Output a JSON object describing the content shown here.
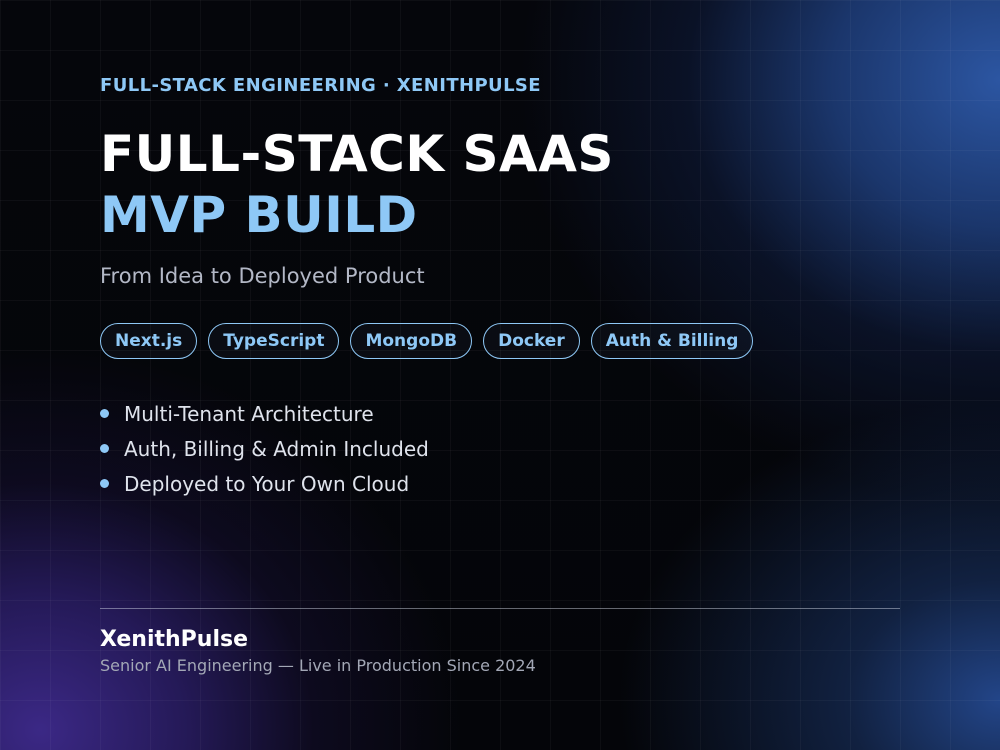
{
  "eyebrow": "FULL-STACK ENGINEERING · XENITHPULSE",
  "title": {
    "line1": "FULL-STACK SAAS",
    "line2": "MVP BUILD"
  },
  "subtitle": "From Idea to Deployed Product",
  "tags": [
    "Next.js",
    "TypeScript",
    "MongoDB",
    "Docker",
    "Auth & Billing"
  ],
  "bullets": [
    "Multi-Tenant Architecture",
    "Auth, Billing & Admin Included",
    "Deployed to Your Own Cloud"
  ],
  "footer": {
    "brand": "XenithPulse",
    "tagline": "Senior AI Engineering — Live in Production Since 2024"
  },
  "colors": {
    "accent": "#8ec8f6",
    "background": "#05060b",
    "glow_blue": "#2e5aaa",
    "glow_purple": "#3e2a8c"
  }
}
